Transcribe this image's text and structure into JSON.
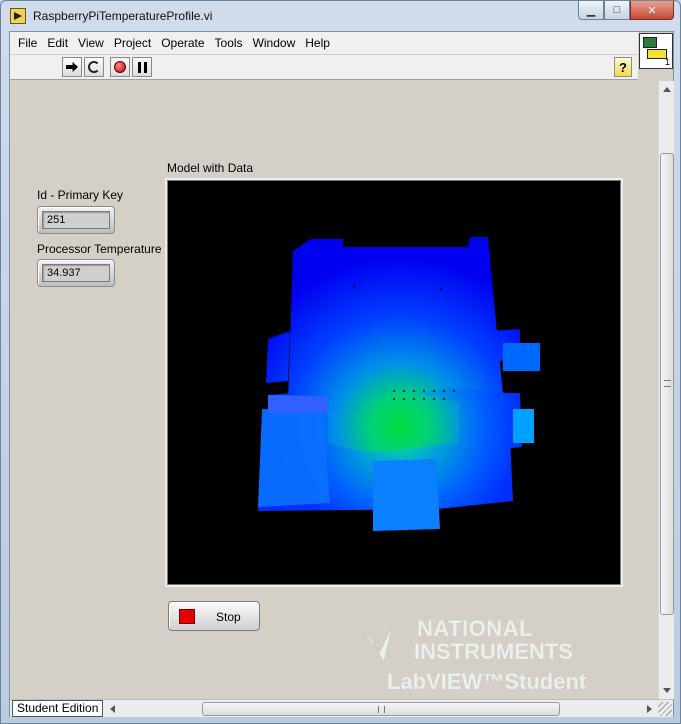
{
  "window": {
    "title": "RaspberryPiTemperatureProfile.vi",
    "controls": {
      "minimize": "▁",
      "maximize": "□",
      "close": "✕"
    }
  },
  "menu": {
    "items": [
      "File",
      "Edit",
      "View",
      "Project",
      "Operate",
      "Tools",
      "Window",
      "Help"
    ]
  },
  "toolbar": {
    "help_label": "?",
    "vi_icon_number": "1"
  },
  "panel": {
    "primary_key_label": "Id - Primary Key",
    "primary_key_value": "251",
    "temperature_label": "Processor Temperature",
    "temperature_value": "34.937",
    "model_label": "Model with Data",
    "stop_label": "Stop"
  },
  "watermark": {
    "line1": "NATIONAL",
    "line2": "INSTRUMENTS",
    "line3": "LabVIEW™Student Edition"
  },
  "statusbar": {
    "edition": "Student Edition"
  },
  "colors": {
    "model_background": "#000000",
    "model_cold": "#0000ff",
    "model_hot": "#00e040",
    "stop_led": "#e60000"
  }
}
